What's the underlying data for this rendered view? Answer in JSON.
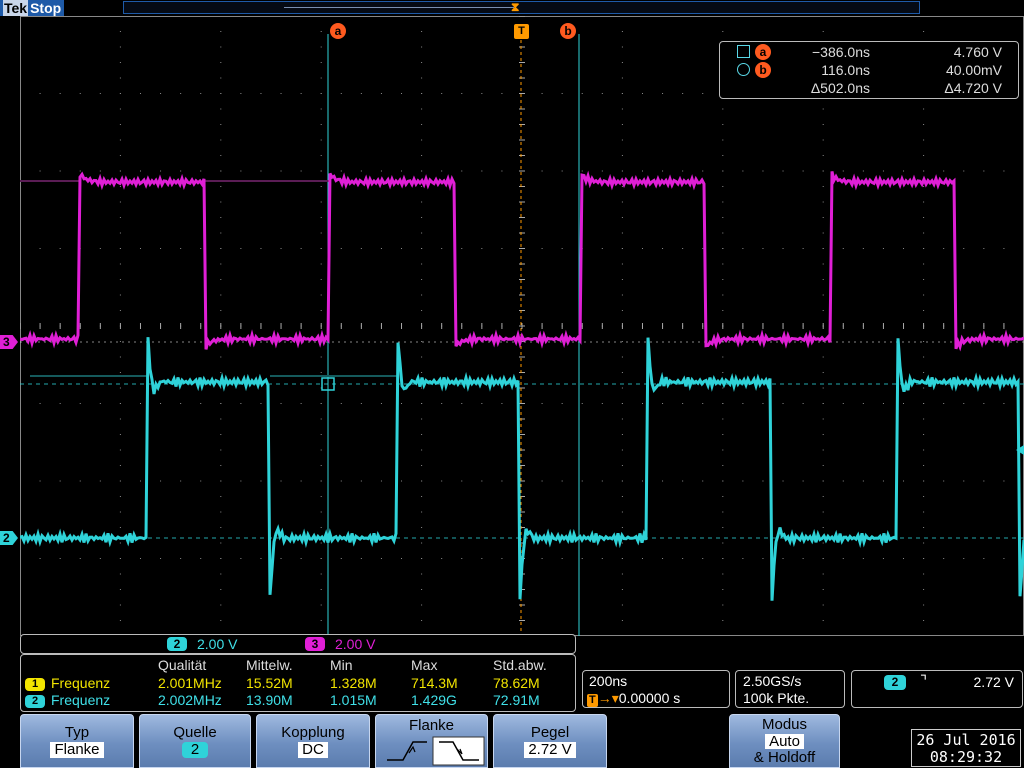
{
  "status": {
    "brand": "Tek",
    "run_state": "Stop"
  },
  "colors": {
    "ch1": "#f2e500",
    "ch2": "#2fd3d9",
    "ch3": "#e01fd6",
    "trigger": "#ff9a00",
    "cursor": "#ff5a1f",
    "grid": "#777777",
    "softkey": "#7f9fcf"
  },
  "markers": {
    "cursor_a": "a",
    "cursor_b": "b",
    "trigger": "T",
    "ch3": "3",
    "ch2": "2"
  },
  "cursor_readout": {
    "a": {
      "time": "−386.0ns",
      "value": "4.760 V"
    },
    "b": {
      "time": "116.0ns",
      "value": "40.00mV"
    },
    "delta": {
      "time": "Δ502.0ns",
      "value": "Δ4.720 V"
    }
  },
  "channel_scales": [
    {
      "channel": "2",
      "scale": "2.00 V"
    },
    {
      "channel": "3",
      "scale": "2.00 V"
    }
  ],
  "measurements": {
    "headers": [
      "Qualität",
      "Mittelw.",
      "Min",
      "Max",
      "Std.abw."
    ],
    "rows": [
      {
        "channel": "1",
        "name": "Frequenz",
        "value": "2.001MHz",
        "mean": "15.52M",
        "min": "1.328M",
        "max": "714.3M",
        "std": "78.62M"
      },
      {
        "channel": "2",
        "name": "Frequenz",
        "value": "2.002MHz",
        "mean": "13.90M",
        "min": "1.015M",
        "max": "1.429G",
        "std": "72.91M"
      }
    ]
  },
  "timebase": {
    "scale": "200ns",
    "position": "0.00000 s"
  },
  "acquisition": {
    "rate": "2.50GS/s",
    "record": "100k Pkte."
  },
  "trigger_status": {
    "source": "2",
    "slope_icon": "falling-edge-icon",
    "level": "2.72 V"
  },
  "softkeys": [
    {
      "label": "Typ",
      "value": "Flanke"
    },
    {
      "label": "Quelle",
      "value": "2"
    },
    {
      "label": "Kopplung",
      "value": "DC"
    },
    {
      "label": "Flanke",
      "value": ""
    },
    {
      "label": "Pegel",
      "value": "2.72 V"
    },
    {
      "label": "Modus",
      "value": "Auto",
      "value2": "& Holdoff"
    }
  ],
  "datetime": {
    "date": "26 Jul  2016",
    "time": "08:29:32"
  }
}
